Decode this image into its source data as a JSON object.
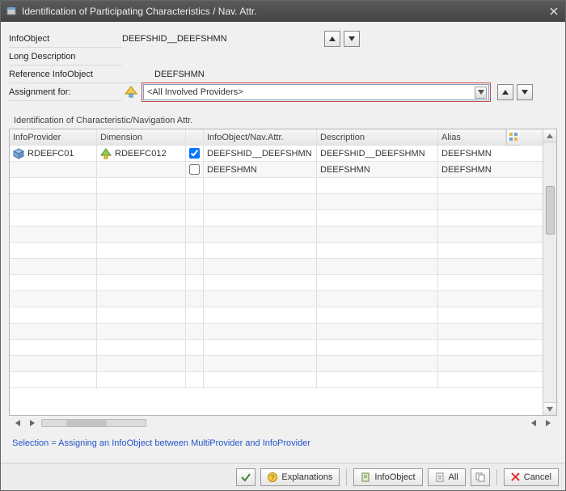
{
  "titlebar": {
    "title": "Identification of Participating Characteristics / Nav. Attr."
  },
  "form": {
    "infoobject_label": "InfoObject",
    "infoobject_value": "DEEFSHID__DEEFSHMN",
    "longdesc_label": "Long Description",
    "longdesc_value": "",
    "refobj_label": "Reference InfoObject",
    "refobj_value": "DEEFSHMN",
    "assign_label": "Assignment for:",
    "provider_value": "<All Involved Providers>"
  },
  "section_title": "Identification of Characteristic/Navigation Attr.",
  "columns": {
    "infoprovider": "InfoProvider",
    "dimension": "Dimension",
    "infoobj": "InfoObject/Nav.Attr.",
    "description": "Description",
    "alias": "Alias"
  },
  "rows": [
    {
      "infoprovider": "RDEEFC01",
      "dimension": "RDEEFC012",
      "checked": true,
      "infoobj": "DEEFSHID__DEEFSHMN",
      "description": "DEEFSHID__DEEFSHMN",
      "alias": "DEEFSHMN"
    },
    {
      "infoprovider": "",
      "dimension": "",
      "checked": false,
      "infoobj": "DEEFSHMN",
      "description": "DEEFSHMN",
      "alias": "DEEFSHMN"
    }
  ],
  "note": "Selection = Assigning an InfoObject between MultiProvider and InfoProvider",
  "footer": {
    "explanations": "Explanations",
    "infoobject": "InfoObject",
    "all": "All",
    "cancel": "Cancel"
  }
}
